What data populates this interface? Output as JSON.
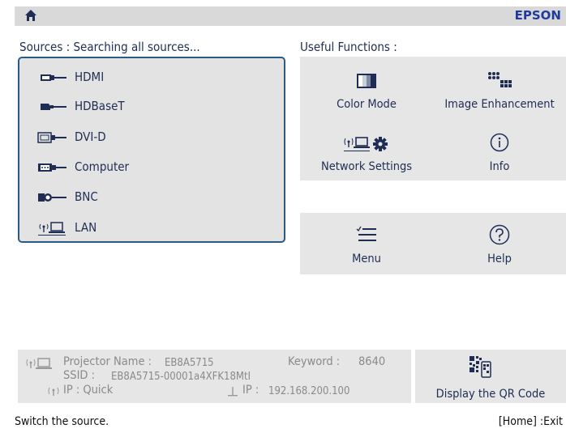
{
  "header": {
    "brand": "EPSON",
    "home_icon": "home-icon"
  },
  "sources": {
    "title": "Sources : Searching all sources...",
    "items": [
      {
        "label": "HDMI",
        "icon": "hdmi-connector-icon"
      },
      {
        "label": "HDBaseT",
        "icon": "hdbaset-connector-icon"
      },
      {
        "label": "DVI-D",
        "icon": "dvi-connector-icon"
      },
      {
        "label": "Computer",
        "icon": "vga-connector-icon"
      },
      {
        "label": "BNC",
        "icon": "bnc-connector-icon"
      },
      {
        "label": "LAN",
        "icon": "lan-icon"
      }
    ]
  },
  "useful": {
    "title": "Useful Functions :",
    "buttons": [
      {
        "label": "Color Mode",
        "icon": "color-mode-icon"
      },
      {
        "label": "Image Enhancement",
        "icon": "image-enhancement-icon"
      },
      {
        "label": "Network Settings",
        "icon": "network-settings-icon"
      },
      {
        "label": "Info",
        "icon": "info-icon"
      },
      {
        "label": "Menu",
        "icon": "menu-icon"
      },
      {
        "label": "Help",
        "icon": "help-icon"
      }
    ]
  },
  "network_info": {
    "projector_name_label": "Projector Name :",
    "projector_name_value": "EB8A5715",
    "keyword_label": "Keyword :",
    "keyword_value": "8640",
    "ssid_label": "SSID :",
    "ssid_value": "EB8A5715-00001a4XFK18MtI",
    "wireless_ip_label": "IP : Quick",
    "wired_ip_label": "IP :",
    "wired_ip_value": "192.168.200.100"
  },
  "qr": {
    "label": "Display the QR Code",
    "icon": "qr-code-icon"
  },
  "footer": {
    "status": "Switch the source.",
    "exit_hint": "[Home] :Exit"
  }
}
